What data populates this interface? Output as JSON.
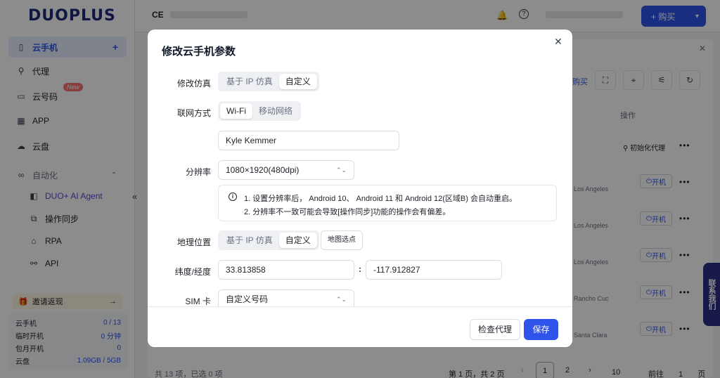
{
  "sidebar": {
    "logo": "DUOPLUS",
    "items": [
      {
        "label": "云手机",
        "icon": "phone-icon"
      },
      {
        "label": "代理",
        "icon": "network-icon"
      },
      {
        "label": "云号码",
        "icon": "sim-icon",
        "badge": "New"
      },
      {
        "label": "APP",
        "icon": "apps-grid-icon"
      },
      {
        "label": "云盘",
        "icon": "cloud-icon"
      },
      {
        "label": "自动化",
        "icon": "infinity-icon"
      }
    ],
    "sub_items": [
      {
        "label": "DUO+ AI Agent"
      },
      {
        "label": "操作同步"
      },
      {
        "label": "RPA"
      },
      {
        "label": "API"
      }
    ],
    "invite": "邀请返现",
    "stats": [
      {
        "label": "云手机",
        "value": "0 / 13"
      },
      {
        "label": "临时开机",
        "value": "0 分钟"
      },
      {
        "label": "包月开机",
        "value": "0"
      },
      {
        "label": "云盘",
        "value": "1.09GB / 5GB"
      }
    ]
  },
  "topbar": {
    "team_prefix": "CE",
    "buy_label": "+ 购买"
  },
  "background": {
    "buy_link": "购买",
    "op_header": "操作",
    "init_proxy": "初始化代理",
    "power_on": "开机",
    "locations": [
      "Los Angeles",
      "Los Angeles",
      "Los Angeles",
      "Rancho Cuc",
      "Santa Clara"
    ],
    "footer_count": "共 13 项，已选 0 项",
    "pager_text": "第 1 页，共 2 页",
    "page_1": "1",
    "page_2": "2",
    "page_size": "10",
    "goto_label": "前往",
    "goto_value": "1",
    "goto_suffix": "页",
    "contact": "联系我们"
  },
  "modal": {
    "title": "修改云手机参数",
    "fields": {
      "emulation": {
        "label": "修改仿真",
        "options": [
          "基于 IP 仿真",
          "自定义"
        ],
        "selected": "自定义"
      },
      "network": {
        "label": "联网方式",
        "options": [
          "Wi-Fi",
          "移动网络"
        ],
        "selected": "Wi-Fi"
      },
      "wifi_name": {
        "value": "Kyle Kemmer"
      },
      "resolution": {
        "label": "分辨率",
        "value": "1080×1920(480dpi)"
      },
      "notes": [
        "1. 设置分辨率后， Android 10、 Android 11 和 Android 12(区域B) 会自动重启。",
        "2. 分辨率不一致可能会导致[操作同步]功能的操作会有偏差。"
      ],
      "location": {
        "label": "地理位置",
        "options": [
          "基于 IP 仿真",
          "自定义"
        ],
        "selected": "自定义",
        "map_button": "地图选点"
      },
      "latlng": {
        "label": "纬度/经度",
        "lat": "33.813858",
        "lng": "-117.912827",
        "separator": ":"
      },
      "sim": {
        "label": "SIM 卡",
        "value": "自定义号码"
      }
    },
    "buttons": {
      "check_proxy": "检查代理",
      "save": "保存"
    }
  },
  "colors": {
    "primary": "#2f54eb",
    "overlay": "rgba(0,0,0,0.45)"
  }
}
